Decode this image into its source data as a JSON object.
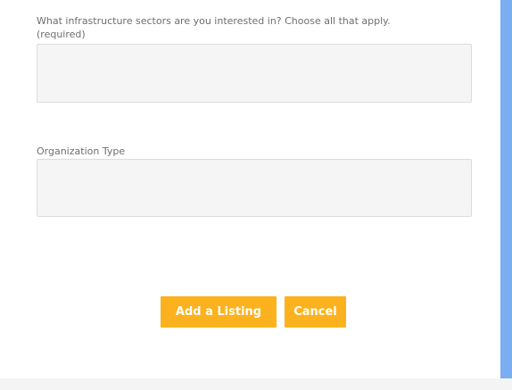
{
  "form": {
    "sectors_question": {
      "line1": "What infrastructure sectors are you interested in? Choose all that apply.",
      "line2": "(required)",
      "value": ""
    },
    "organization_type": {
      "label": "Organization Type",
      "value": ""
    },
    "buttons": {
      "add_listing": "Add a Listing",
      "cancel": "Cancel"
    }
  },
  "colors": {
    "button_bg": "#fbb21e",
    "button_text": "#ffffff",
    "scroll_accent": "#7aaef0",
    "field_bg": "#f5f5f5"
  }
}
